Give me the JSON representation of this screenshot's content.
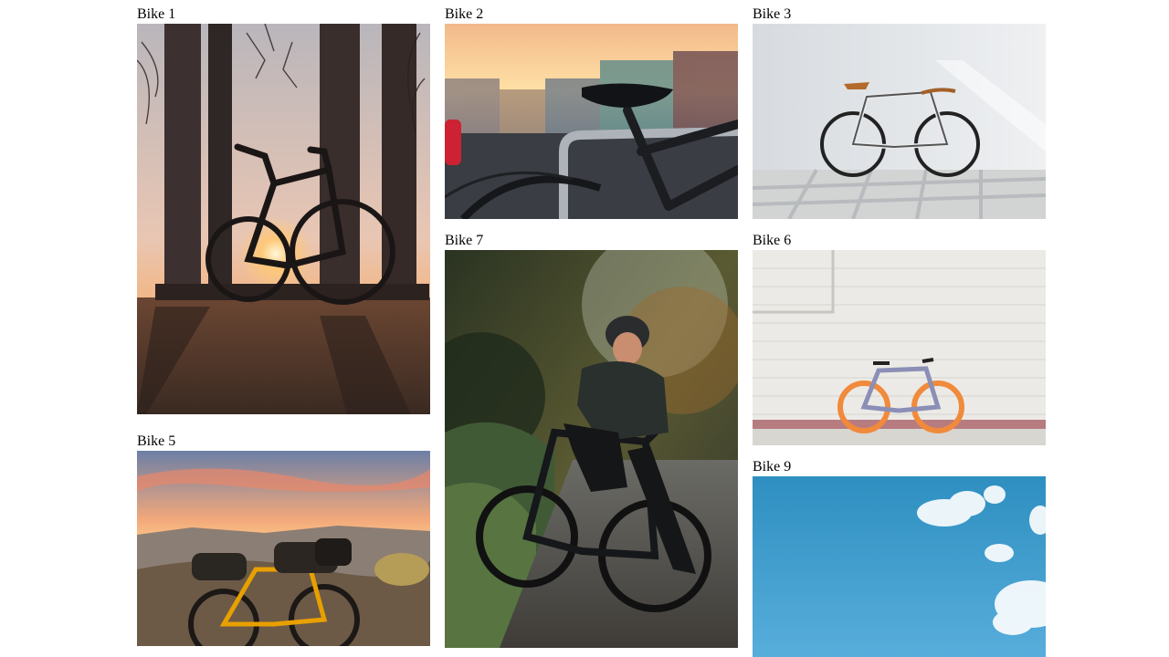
{
  "gallery": {
    "cards": [
      {
        "label": "Bike 1",
        "photo": "silhouette-bike-columns-sunset"
      },
      {
        "label": "Bike 2",
        "photo": "bike-seat-railing-city"
      },
      {
        "label": "Bike 3",
        "photo": "silver-bike-white-wall"
      },
      {
        "label": "Bike 7",
        "photo": "cyclist-helmet-dark-bike-forest"
      },
      {
        "label": "Bike 6",
        "photo": "blue-bike-orange-tires-brick-wall"
      },
      {
        "label": "Bike 5",
        "photo": "loaded-bike-mountain-sunset"
      },
      {
        "label": "Bike 9",
        "photo": "blue-sky-clouds"
      }
    ]
  }
}
